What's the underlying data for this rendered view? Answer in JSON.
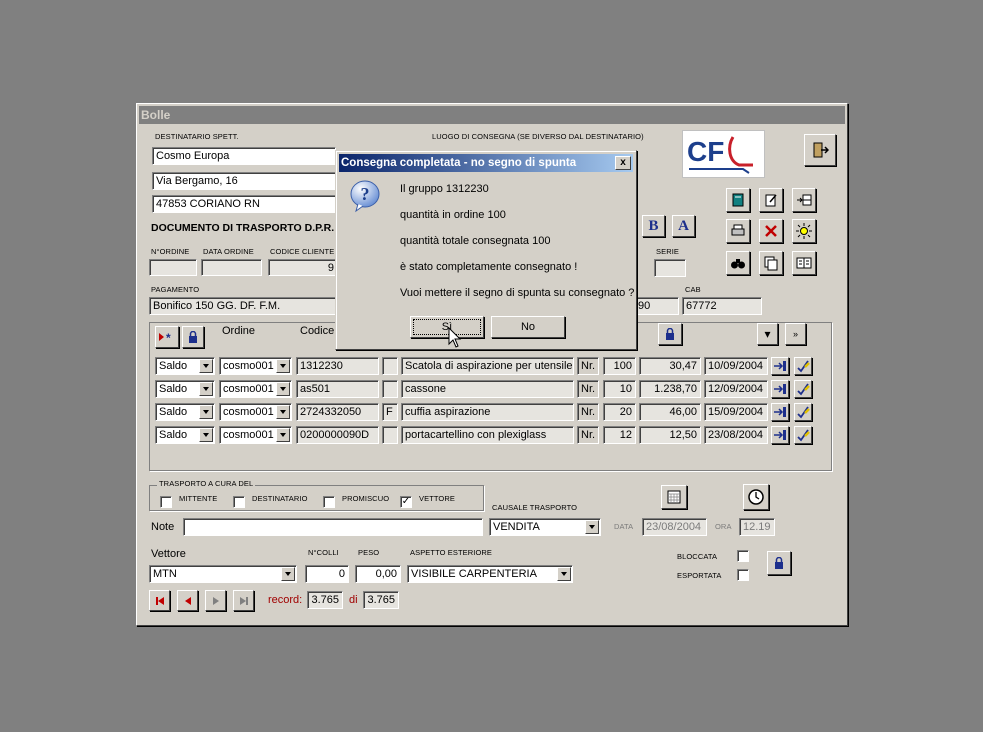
{
  "window": {
    "title": "Bolle"
  },
  "destinatario": {
    "label": "DESTINATARIO SPETT.",
    "name": "Cosmo Europa",
    "address": "Via Bergamo, 16",
    "city": "47853 CORIANO RN"
  },
  "luogo_label": "LUOGO DI CONSEGNA (SE DIVERSO DAL DESTINATARIO)",
  "logo": {
    "text": "CF"
  },
  "documento_label": "DOCUMENTO DI TRASPORTO D.P.R.",
  "ordine": {
    "n_label": "N°ORDINE",
    "data_label": "DATA ORDINE",
    "codice_label": "CODICE CLIENTE",
    "codice_value": "9"
  },
  "serie_label": "SERIE",
  "pagamento": {
    "label": "PAGAMENTO",
    "value": "Bonifico 150 GG. DF. F.M.",
    "abi_partial": "90"
  },
  "cab": {
    "label": "CAB",
    "value": "67772"
  },
  "format_buttons": {
    "bold": "B",
    "text": "A"
  },
  "grid_headers": {
    "ordine": "Ordine",
    "codice": "Codice"
  },
  "rows": [
    {
      "tipo": "Saldo",
      "cliente": "cosmo001",
      "codice": "1312230",
      "flag": "",
      "descr": "Scatola di aspirazione per utensile c",
      "um": "Nr.",
      "qty": "100",
      "price": "30,47",
      "date": "10/09/2004"
    },
    {
      "tipo": "Saldo",
      "cliente": "cosmo001",
      "codice": "as501",
      "flag": "",
      "descr": "cassone",
      "um": "Nr.",
      "qty": "10",
      "price": "1.238,70",
      "date": "12/09/2004"
    },
    {
      "tipo": "Saldo",
      "cliente": "cosmo001",
      "codice": "2724332050",
      "flag": "F",
      "descr": "cuffia aspirazione",
      "um": "Nr.",
      "qty": "20",
      "price": "46,00",
      "date": "15/09/2004"
    },
    {
      "tipo": "Saldo",
      "cliente": "cosmo001",
      "codice": "0200000090D",
      "flag": "",
      "descr": "portacartellino con plexiglass",
      "um": "Nr.",
      "qty": "12",
      "price": "12,50",
      "date": "23/08/2004"
    }
  ],
  "trasporto": {
    "label": "TRASPORTO A CURA DEL",
    "mittente": "MITTENTE",
    "destinatario": "DESTINATARIO",
    "promiscuo": "PROMISCUO",
    "vettore": "VETTORE",
    "vettore_check": "✓"
  },
  "causale": {
    "label": "CAUSALE TRASPORTO",
    "value": "VENDITA"
  },
  "data": {
    "label": "DATA",
    "value": "23/08/2004"
  },
  "ora": {
    "label": "ORA",
    "value": "12.19"
  },
  "note": {
    "label": "Note",
    "value": ""
  },
  "vettore": {
    "label": "Vettore",
    "value": "MTN"
  },
  "colli": {
    "label": "N°COLLI",
    "value": "0"
  },
  "peso": {
    "label": "PESO",
    "value": "0,00"
  },
  "aspetto": {
    "label": "ASPETTO ESTERIORE",
    "value": "VISIBILE CARPENTERIA"
  },
  "bloccata_label": "BLOCCATA",
  "esportata_label": "ESPORTATA",
  "record": {
    "label": "record:",
    "current": "3.765",
    "of_label": "di",
    "total": "3.765"
  },
  "dialog": {
    "title": "Consegna completata - no segno di spunta",
    "close": "x",
    "icon": "?",
    "lines": [
      "Il gruppo 1312230",
      "quantità in ordine 100",
      "quantità totale consegnata 100",
      "è stato completamente consegnato !",
      "Vuoi mettere il segno di spunta su consegnato ?"
    ],
    "yes": "Sì",
    "no": "No"
  },
  "colors": {
    "title_active": "#0a246a",
    "title_inactive": "#808080",
    "face": "#d4d0c8",
    "record_red": "#a00000"
  }
}
